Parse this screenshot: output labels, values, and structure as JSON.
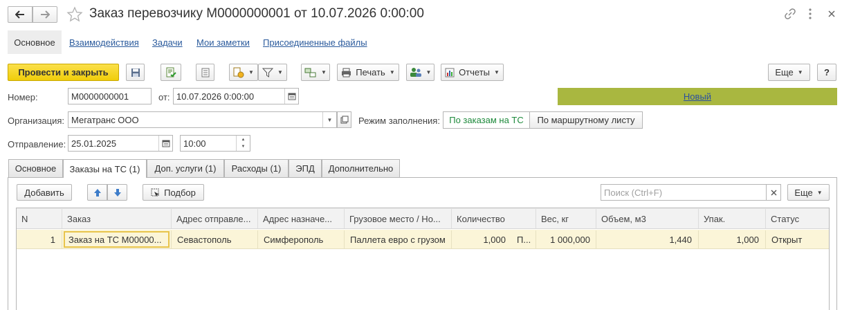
{
  "window": {
    "title": "Заказ перевозчику М0000000001 от 10.07.2026 0:00:00"
  },
  "nav_tabs": [
    {
      "label": "Основное"
    },
    {
      "label": "Взаимодействия"
    },
    {
      "label": "Задачи"
    },
    {
      "label": "Мои заметки"
    },
    {
      "label": "Присоединенные файлы"
    }
  ],
  "toolbar": {
    "post_close": "Провести и закрыть",
    "print": "Печать",
    "reports": "Отчеты",
    "more": "Еще",
    "help": "?"
  },
  "form": {
    "number_label": "Номер:",
    "number_value": "М0000000001",
    "date_label": "от:",
    "date_value": "10.07.2026  0:00:00",
    "status": "Новый",
    "org_label": "Организация:",
    "org_value": "Мегатранс ООО",
    "fill_mode_label": "Режим заполнения:",
    "fill_mode_options": [
      "По заказам на ТС",
      "По маршрутному листу"
    ],
    "dispatch_label": "Отправление:",
    "dispatch_date": "25.01.2025",
    "dispatch_time": "10:00"
  },
  "colors": {
    "status_bar": "#a9b740",
    "primary_button": "#f5d40e",
    "selected_row": "#fbf5d8"
  },
  "section_tabs": [
    {
      "label": "Основное"
    },
    {
      "label": "Заказы на ТС (1)"
    },
    {
      "label": "Доп. услуги (1)"
    },
    {
      "label": "Расходы (1)"
    },
    {
      "label": "ЭПД"
    },
    {
      "label": "Дополнительно"
    }
  ],
  "table_toolbar": {
    "add": "Добавить",
    "pick": "Подбор",
    "search_placeholder": "Поиск (Ctrl+F)",
    "more": "Еще"
  },
  "table": {
    "columns": [
      "N",
      "Заказ",
      "Адрес отправле...",
      "Адрес назначе...",
      "Грузовое место / Но...",
      "Количество",
      "Вес, кг",
      "Объем, м3",
      "Упак.",
      "Статус"
    ],
    "rows": [
      [
        "1",
        "Заказ на ТС М00000...",
        "Севастополь",
        "Симферополь",
        "Паллета евро с грузом",
        "1,000",
        "П...",
        "1 000,000",
        "1,440",
        "1,000",
        "Открыт"
      ]
    ]
  }
}
